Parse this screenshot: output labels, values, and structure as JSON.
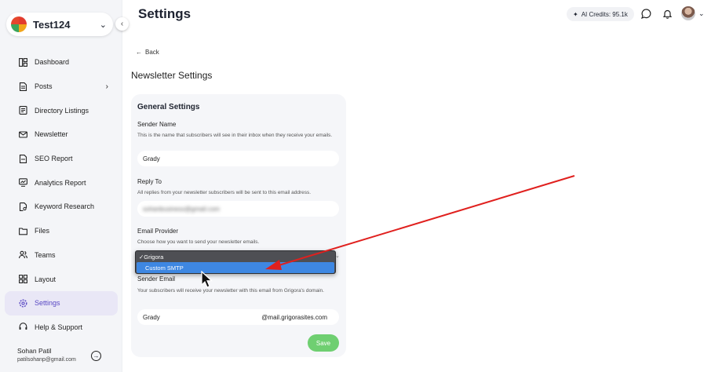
{
  "workspace": {
    "name": "Test124"
  },
  "sidebar": {
    "items": [
      {
        "label": "Dashboard",
        "icon": "dashboard-icon"
      },
      {
        "label": "Posts",
        "icon": "posts-icon"
      },
      {
        "label": "Directory Listings",
        "icon": "directory-icon"
      },
      {
        "label": "Newsletter",
        "icon": "mail-icon"
      },
      {
        "label": "SEO Report",
        "icon": "seo-icon"
      },
      {
        "label": "Analytics Report",
        "icon": "analytics-icon"
      },
      {
        "label": "Keyword Research",
        "icon": "keyword-icon"
      },
      {
        "label": "Files",
        "icon": "folder-icon"
      },
      {
        "label": "Teams",
        "icon": "teams-icon"
      },
      {
        "label": "Layout",
        "icon": "layout-icon"
      },
      {
        "label": "Settings",
        "icon": "settings-icon",
        "active": true
      },
      {
        "label": "Help & Support",
        "icon": "help-icon"
      }
    ],
    "user": {
      "name": "Sohan Patil",
      "email": "patilsohanp@gmail.com"
    }
  },
  "header": {
    "title": "Settings",
    "credits": "AI Credits: 95.1k"
  },
  "back_label": "Back",
  "section_title": "Newsletter Settings",
  "general": {
    "title": "General Settings",
    "sender_name": {
      "label": "Sender Name",
      "hint": "This is the name that subscribers will see in their inbox when they receive your emails.",
      "value": "Grady"
    },
    "reply_to": {
      "label": "Reply To",
      "hint": "All replies from your newsletter subscribers will be sent to this email address.",
      "value": "sohanbusiness@gmail.com"
    },
    "provider": {
      "label": "Email Provider",
      "hint": "Choose how you want to send your newsletter emails.",
      "options": [
        "Grigora",
        "Custom SMTP"
      ],
      "selected": "Grigora",
      "highlighted": "Custom SMTP"
    },
    "sender_email": {
      "label": "Sender Email",
      "hint": "Your subscribers will receive your newsletter with this email from Grigora's domain.",
      "value": "Grady",
      "domain": "@mail.grigorasites.com"
    },
    "save_label": "Save"
  },
  "colors": {
    "accent": "#5a49c4",
    "save": "#6fcf71",
    "highlight": "#3e87e2",
    "annotation_arrow": "#e0201e"
  }
}
